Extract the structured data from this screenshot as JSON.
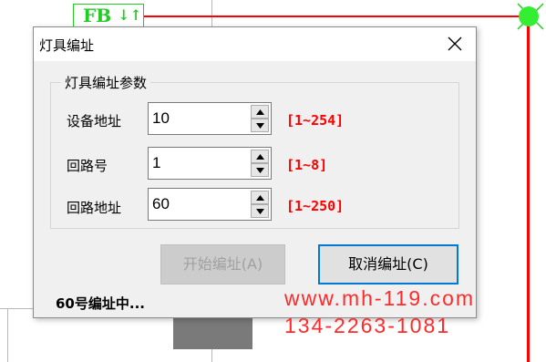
{
  "background": {
    "tag_text": "FB",
    "tag_arrow": "↓↑"
  },
  "dialog": {
    "title": "灯具编址",
    "group_title": "灯具编址参数",
    "fields": [
      {
        "label": "设备地址",
        "value": "10",
        "range": "[1~254]"
      },
      {
        "label": "回路号",
        "value": "1",
        "range": "[1~8]"
      },
      {
        "label": "回路地址",
        "value": "60",
        "range": "[1~250]"
      }
    ],
    "start_button": "开始编址(A)",
    "cancel_button": "取消编址(C)",
    "status": "60号编址中..."
  },
  "watermark": {
    "url": "www.mh-119.com",
    "phone": "134-2263-1081"
  },
  "colors": {
    "accent": "#0078d7",
    "range_text": "#ff0000",
    "cad_red": "#ff0000",
    "cad_green": "#22cc22"
  }
}
